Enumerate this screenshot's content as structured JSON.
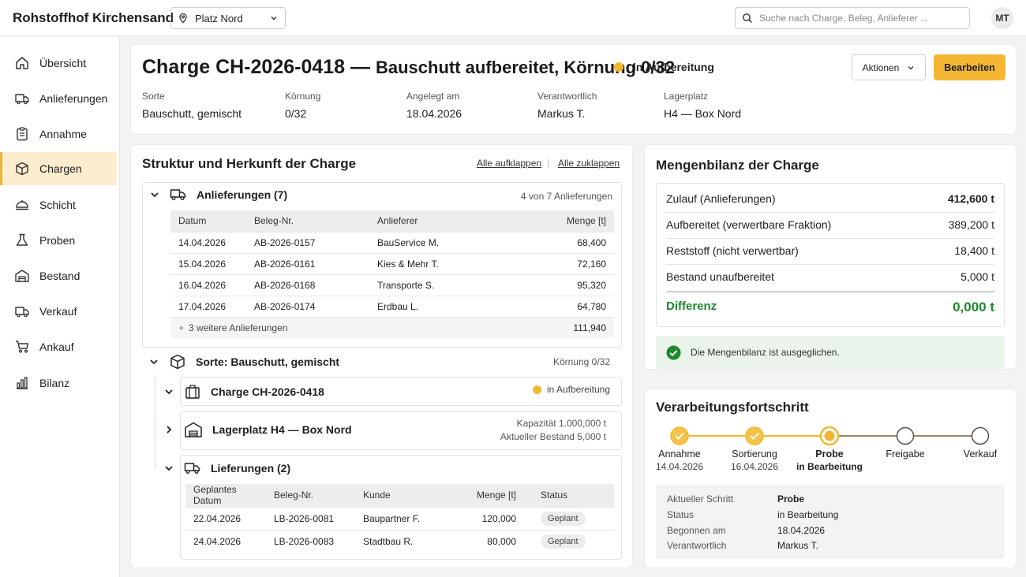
{
  "app": {
    "title": "Rohstoffhof Kirchensand"
  },
  "location": {
    "value": "Platz Nord"
  },
  "search": {
    "placeholder": "Suche nach Charge, Beleg, Anlieferer ..."
  },
  "user": {
    "initials": "MT"
  },
  "sidebar": {
    "active": "Chargen",
    "items": [
      {
        "label": "Übersicht",
        "icon": "home-icon"
      },
      {
        "label": "Anlieferungen",
        "icon": "truck-icon"
      },
      {
        "label": "Annahme",
        "icon": "clipboard-icon"
      },
      {
        "label": "Chargen",
        "icon": "box-icon"
      },
      {
        "label": "Schicht",
        "icon": "shift-icon"
      },
      {
        "label": "Proben",
        "icon": "flask-icon"
      },
      {
        "label": "Bestand",
        "icon": "warehouse-icon"
      },
      {
        "label": "Verkauf",
        "icon": "truck-icon"
      },
      {
        "label": "Ankauf",
        "icon": "cart-icon"
      },
      {
        "label": "Bilanz",
        "icon": "bar-chart-icon"
      }
    ]
  },
  "header": {
    "title_code": "Charge CH-2026-0418",
    "title_sep": "—",
    "title_desc": "Bauschutt aufbereitet, Körnung 0/32",
    "status": "in Aufbereitung",
    "status_color": "#f2b730",
    "actions_label": "Aktionen",
    "edit_label": "Bearbeiten",
    "meta": [
      {
        "label": "Sorte",
        "value": "Bauschutt, gemischt"
      },
      {
        "label": "Körnung",
        "value": "0/32"
      },
      {
        "label": "Angelegt am",
        "value": "18.04.2026"
      },
      {
        "label": "Verantwortlich",
        "value": "Markus T."
      },
      {
        "label": "Lagerplatz",
        "value": "H4 — Box Nord"
      }
    ]
  },
  "structure": {
    "title": "Struktur und Herkunft der Charge",
    "expand_all": "Alle aufklappen",
    "separator": "|",
    "collapse_all": "Alle zuklappen",
    "deliveries": {
      "title": "Anlieferungen (7)",
      "meta": "4 von 7 Anlieferungen",
      "headers": {
        "date": "Datum",
        "doc": "Beleg-Nr.",
        "supplier": "Anlieferer",
        "qty": "Menge [t]"
      },
      "rows": [
        {
          "date": "14.04.2026",
          "doc": "AB-2026-0157",
          "supplier": "BauService M.",
          "qty": "68,400"
        },
        {
          "date": "15.04.2026",
          "doc": "AB-2026-0161",
          "supplier": "Kies & Mehr T.",
          "qty": "72,160"
        },
        {
          "date": "16.04.2026",
          "doc": "AB-2026-0168",
          "supplier": "Transporte S.",
          "qty": "95,320"
        },
        {
          "date": "17.04.2026",
          "doc": "AB-2026-0174",
          "supplier": "Erdbau L.",
          "qty": "64,780"
        }
      ],
      "more_label": "3 weitere Anlieferungen",
      "more_qty": "111,940"
    },
    "sort": {
      "title": "Sorte: Bauschutt, gemischt",
      "meta": "Körnung 0/32"
    },
    "charge": {
      "title": "Charge CH-2026-0418",
      "status": "in Aufbereitung"
    },
    "storage": {
      "title": "Lagerplatz H4 — Box Nord",
      "capacity": "Kapazität 1.000,000 t",
      "stock": "Aktueller Bestand 5,000 t"
    },
    "shipments": {
      "title": "Lieferungen (2)",
      "headers": {
        "date": "Geplantes Datum",
        "doc": "Beleg-Nr.",
        "customer": "Kunde",
        "qty": "Menge [t]",
        "status": "Status"
      },
      "rows": [
        {
          "date": "22.04.2026",
          "doc": "LB-2026-0081",
          "customer": "Baupartner F.",
          "qty": "120,000",
          "status": "Geplant"
        },
        {
          "date": "24.04.2026",
          "doc": "LB-2026-0083",
          "customer": "Stadtbau R.",
          "qty": "80,000",
          "status": "Geplant"
        }
      ]
    }
  },
  "balance": {
    "title": "Mengenbilanz der Charge",
    "rows": [
      {
        "label": "Zulauf (Anlieferungen)",
        "value": "412,600 t"
      },
      {
        "label": "Aufbereitet (verwertbare Fraktion)",
        "value": "389,200 t"
      },
      {
        "label": "Reststoff (nicht verwertbar)",
        "value": "18,400 t"
      },
      {
        "label": "Bestand unaufbereitet",
        "value": "5,000 t"
      }
    ],
    "diff_label": "Differenz",
    "diff_value": "0,000 t",
    "diff_color": "#1e8a2e",
    "ok_message": "Die Mengenbilanz ist ausgeglichen."
  },
  "progress": {
    "title": "Verarbeitungsfortschritt",
    "steps": [
      {
        "name": "Annahme",
        "date": "14.04.2026",
        "state": "done"
      },
      {
        "name": "Sortierung",
        "date": "16.04.2026",
        "state": "done"
      },
      {
        "name": "Probe",
        "date": "in Bearbeitung",
        "state": "current"
      },
      {
        "name": "Freigabe",
        "date": "",
        "state": "open"
      },
      {
        "name": "Verkauf",
        "date": "",
        "state": "open"
      }
    ],
    "details": [
      {
        "label": "Aktueller Schritt",
        "value": "Probe"
      },
      {
        "label": "Status",
        "value": "in Bearbeitung"
      },
      {
        "label": "Begonnen am",
        "value": "18.04.2026"
      },
      {
        "label": "Verantwortlich",
        "value": "Markus T."
      }
    ]
  }
}
